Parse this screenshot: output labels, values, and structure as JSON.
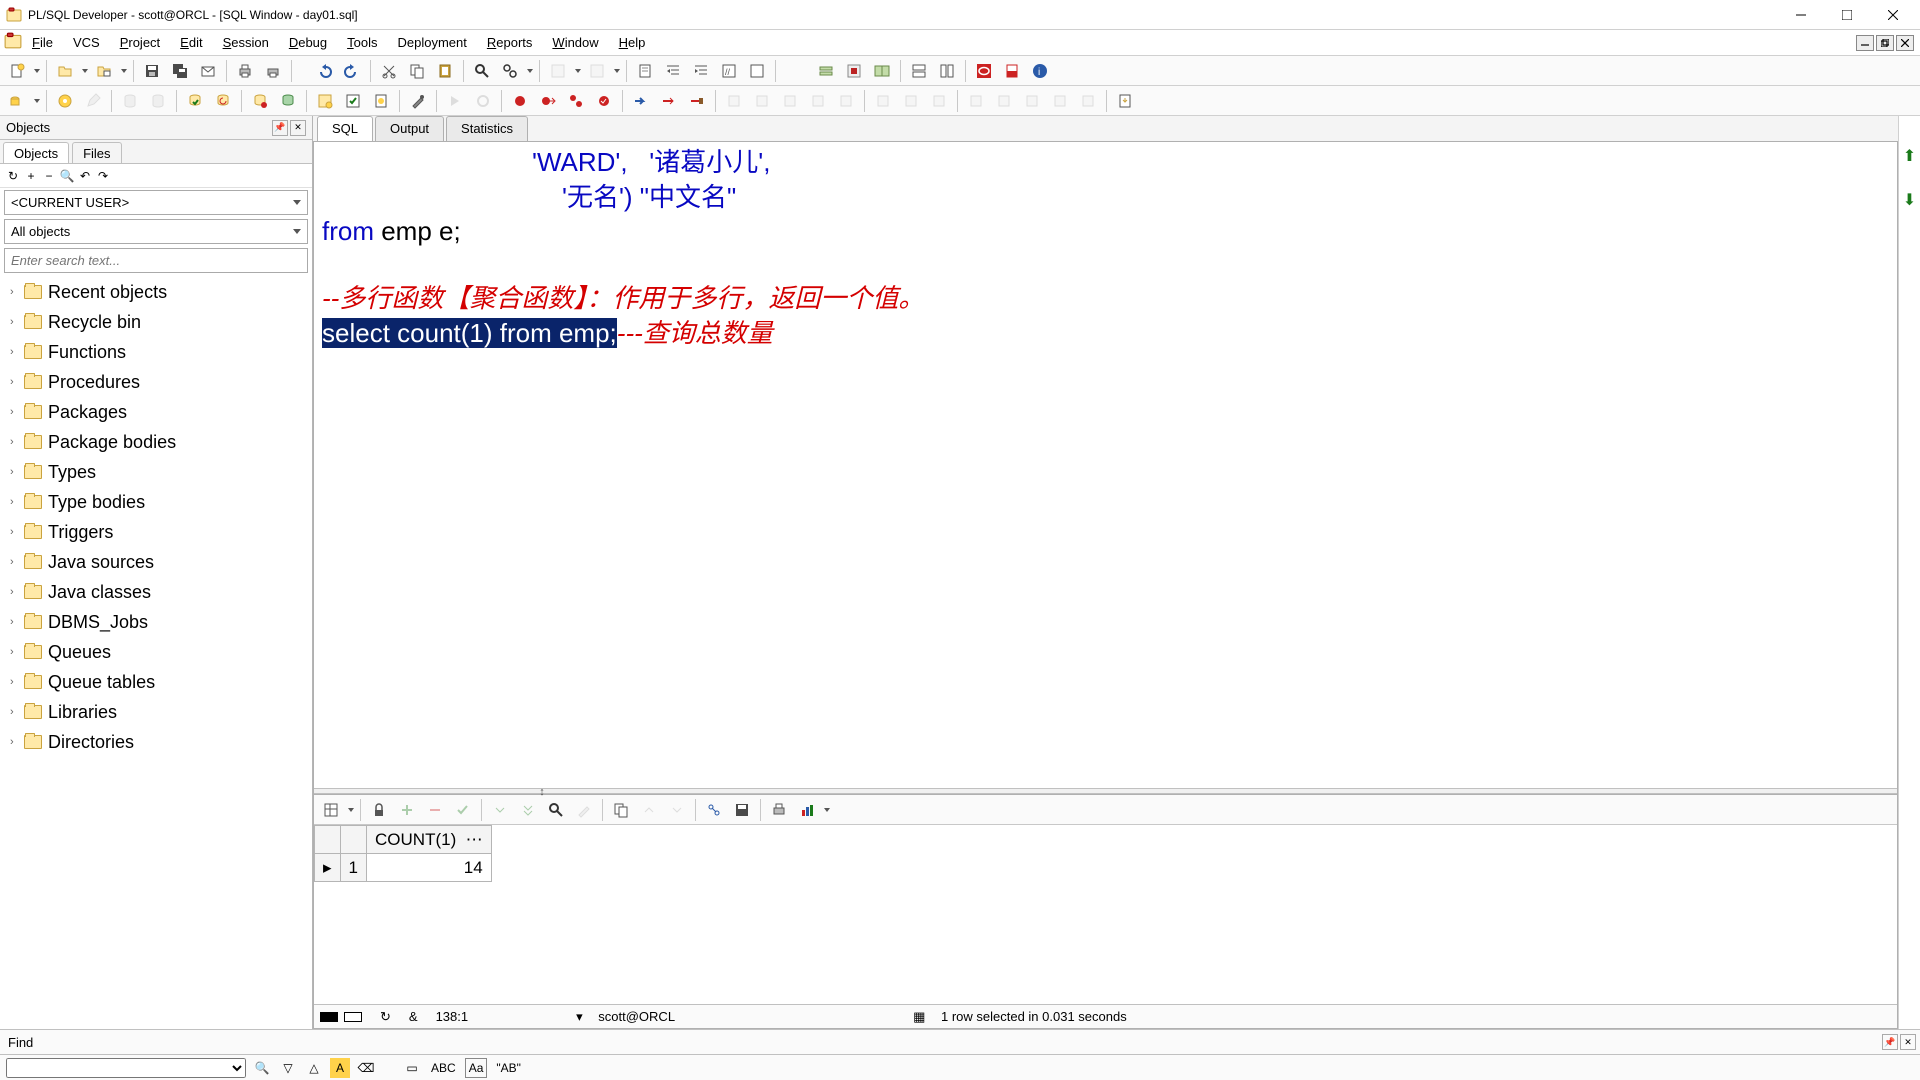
{
  "window": {
    "title": "PL/SQL Developer - scott@ORCL - [SQL Window - day01.sql]"
  },
  "menu": {
    "items": [
      "File",
      "VCS",
      "Project",
      "Edit",
      "Session",
      "Debug",
      "Tools",
      "Deployment",
      "Reports",
      "Window",
      "Help"
    ]
  },
  "sidebar": {
    "panel_title": "Objects",
    "tabs": [
      "Objects",
      "Files"
    ],
    "user_combo": "<CURRENT USER>",
    "filter_combo": "All objects",
    "search_placeholder": "Enter search text...",
    "tree": [
      "Recent objects",
      "Recycle bin",
      "Functions",
      "Procedures",
      "Packages",
      "Package bodies",
      "Types",
      "Type bodies",
      "Triggers",
      "Java sources",
      "Java classes",
      "DBMS_Jobs",
      "Queues",
      "Queue tables",
      "Libraries",
      "Directories"
    ]
  },
  "doc_tabs": [
    "SQL",
    "Output",
    "Statistics"
  ],
  "editor": {
    "line1a": "'WARD',   '诸葛小儿',",
    "line2a": "'无名') \"中文名\"",
    "line3_kw": "from",
    "line3_rest": " emp e;",
    "line4_cmt": "--多行函数【聚合函数】：作用于多行，返回一个值。",
    "line5_sel_kw1": "select",
    "line5_sel_mid": " count(1) ",
    "line5_sel_kw2": "from",
    "line5_sel_end": " emp;",
    "line5_cmt": "---查询总数量"
  },
  "result": {
    "col": "COUNT(1)",
    "rownum": "1",
    "value": "14"
  },
  "status": {
    "cursor": "138:1",
    "conn": "scott@ORCL",
    "msg": "1 row selected in 0.031 seconds"
  },
  "find": {
    "label": "Find",
    "btn_abc": "ABC",
    "btn_ab": "\"AB\""
  }
}
